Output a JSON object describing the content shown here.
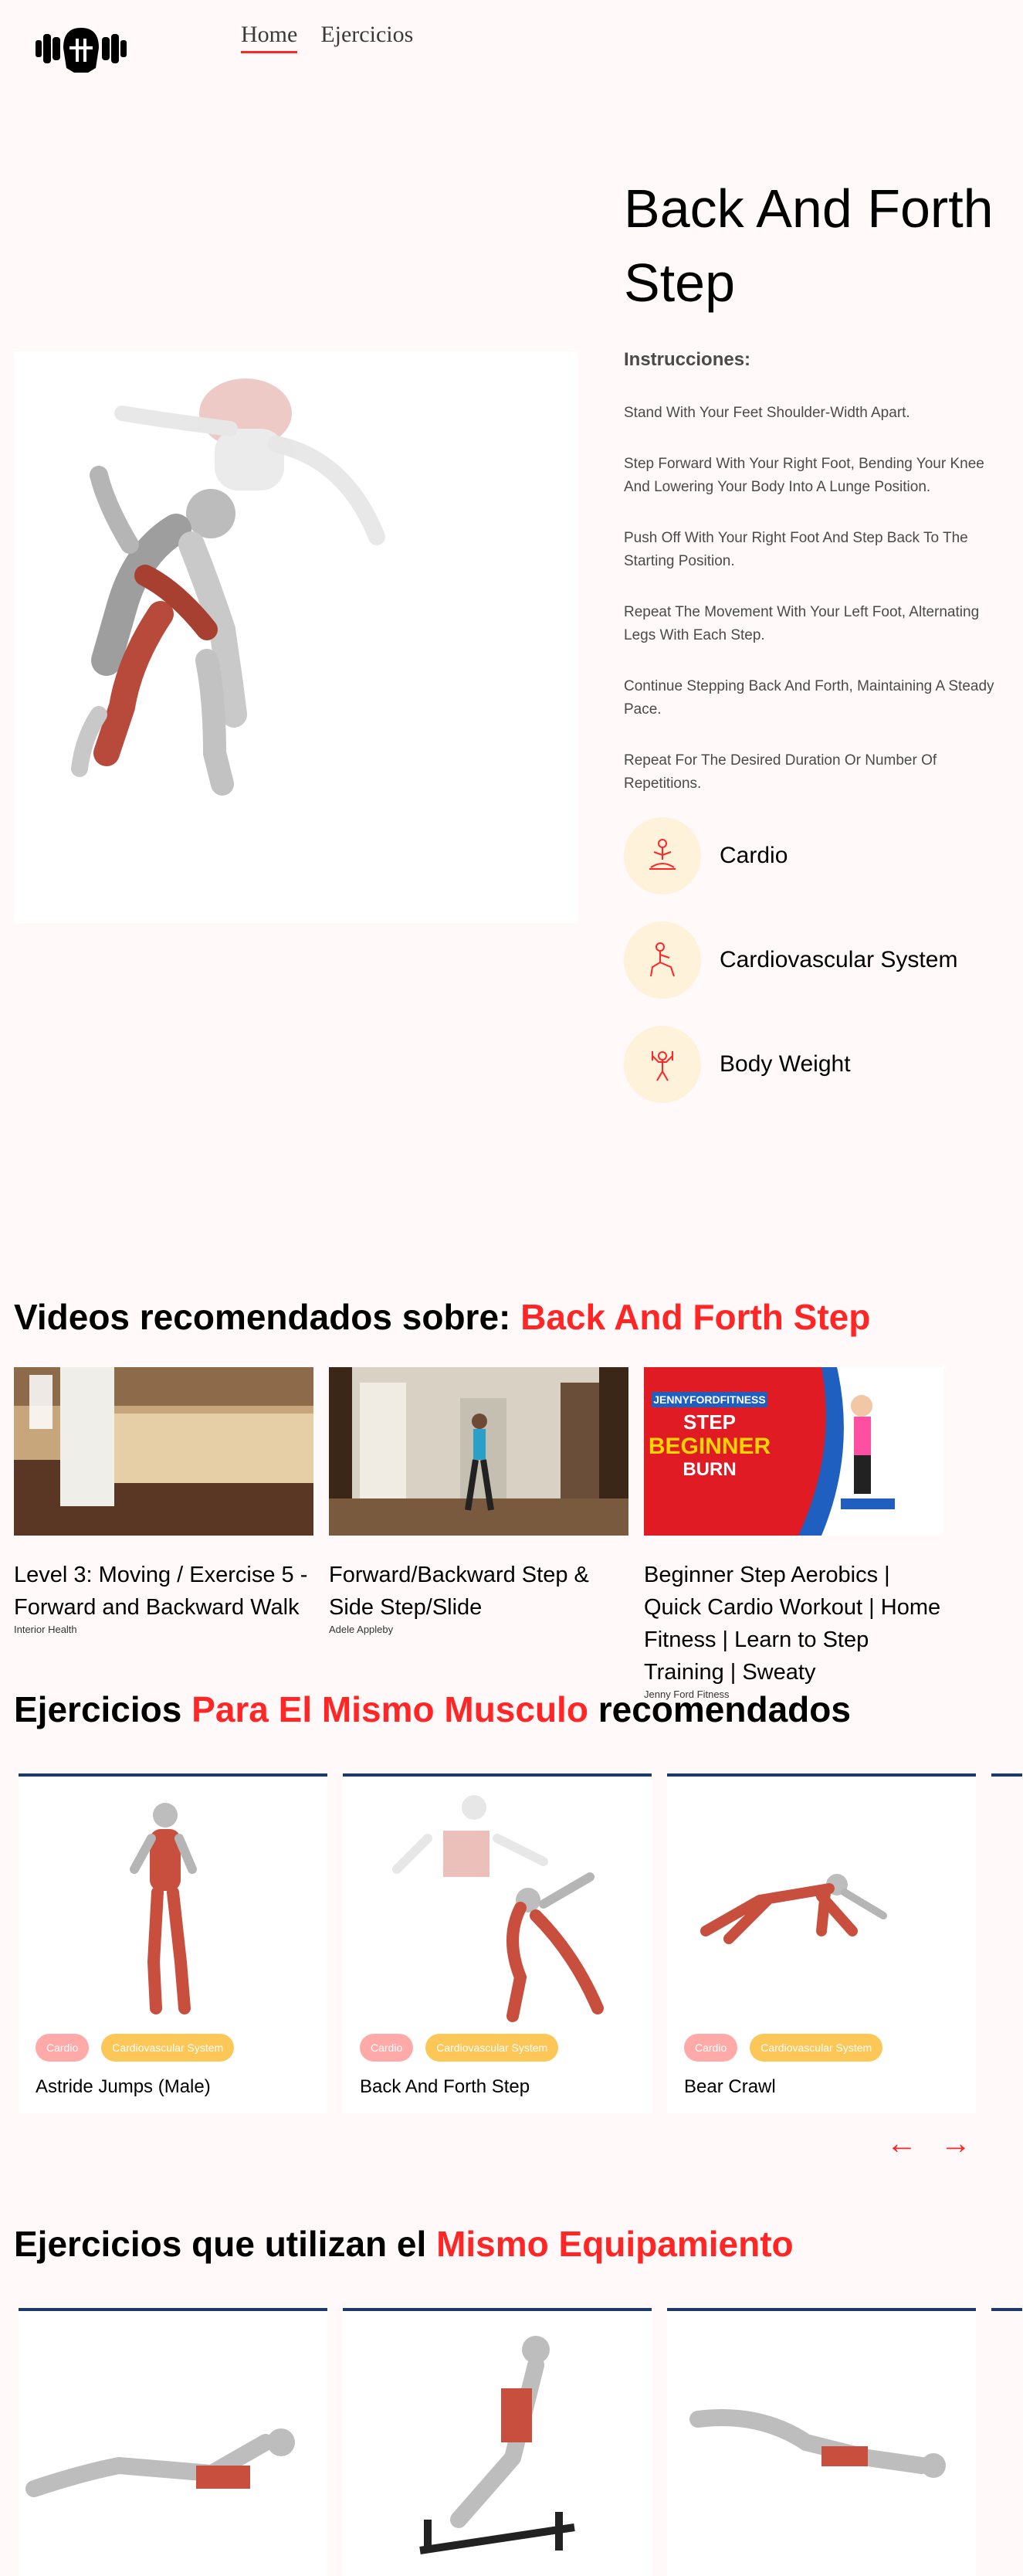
{
  "header": {
    "nav": [
      {
        "label": "Home",
        "active": true
      },
      {
        "label": "Ejercicios",
        "active": false
      }
    ]
  },
  "exercise": {
    "title": "Back And Forth Step",
    "instructions_title": "Instrucciones:",
    "instructions": [
      "Stand With Your Feet Shoulder-Width Apart.",
      "Step Forward With Your Right Foot, Bending Your Knee And Lowering Your Body Into A Lunge Position.",
      "Push Off With Your Right Foot And Step Back To The Starting Position.",
      "Repeat The Movement With Your Left Foot, Alternating Legs With Each Step.",
      "Continue Stepping Back And Forth, Maintaining A Steady Pace.",
      "Repeat For The Desired Duration Or Number Of Repetitions."
    ],
    "badges": [
      {
        "icon": "meditation-icon",
        "label": "Cardio"
      },
      {
        "icon": "lunge-icon",
        "label": "Cardiovascular System"
      },
      {
        "icon": "dumbbell-person-icon",
        "label": "Body Weight"
      }
    ]
  },
  "videos_section": {
    "title_prefix": "Videos recomendados sobre: ",
    "title_highlight": "Back And Forth Step",
    "videos": [
      {
        "title": "Level 3: Moving / Exercise 5 - Forward and Backward Walk",
        "channel": "Interior Health"
      },
      {
        "title": "Forward/Backward Step & Side Step/Slide",
        "channel": "Adele Appleby"
      },
      {
        "title": "Beginner Step Aerobics | Quick Cardio Workout | Home Fitness | Learn to Step Training | Sweaty",
        "channel": "Jenny Ford Fitness",
        "thumb_brand": "JENNYFORDFITNESS",
        "thumb_line1": "STEP",
        "thumb_line2": "BEGINNER",
        "thumb_line3": "BURN"
      }
    ]
  },
  "similar_muscle": {
    "title_prefix": "Ejercicios ",
    "title_highlight": "Para El Mismo Musculo",
    "title_suffix": " recomendados",
    "cards": [
      {
        "name": "Astride Jumps (Male)",
        "tags": [
          "Cardio",
          "Cardiovascular System"
        ]
      },
      {
        "name": "Back And Forth Step",
        "tags": [
          "Cardio",
          "Cardiovascular System"
        ]
      },
      {
        "name": "Bear Crawl",
        "tags": [
          "Cardio",
          "Cardiovascular System"
        ]
      }
    ],
    "prev_arrow": "←",
    "next_arrow": "→"
  },
  "same_equipment": {
    "title_prefix": "Ejercicios que utilizan el ",
    "title_highlight": "Mismo Equipamiento"
  },
  "colors": {
    "accent": "#ff2625",
    "card_border": "#1b3a6b",
    "badge_bg": "#fff2db"
  }
}
